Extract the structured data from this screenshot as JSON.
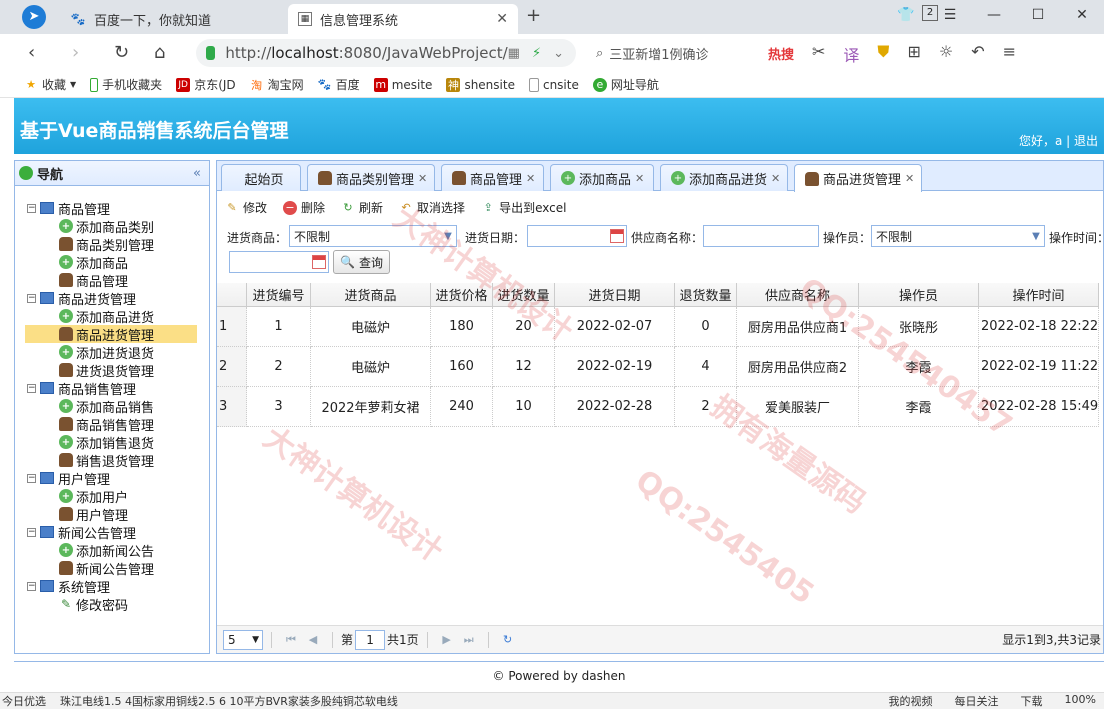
{
  "browser": {
    "tabs": [
      {
        "label": "百度一下，你就知道",
        "icon": "baidu-paw-icon"
      },
      {
        "label": "信息管理系统",
        "icon": "page-icon"
      }
    ],
    "tab_count": "2",
    "url_host": "http://",
    "url_main": "localhost",
    "url_rest": ":8080/JavaWebProject/",
    "search_text": "三亚新增1例确诊",
    "search_hot": "热搜",
    "bookmarks": [
      "收藏",
      "手机收藏夹",
      "京东(JD",
      "淘宝网",
      "百度",
      "mesite",
      "shensite",
      "cnsite",
      "网址导航"
    ],
    "status_left": "今日优选",
    "status_ticker": "珠江电线1.5 4国标家用铜线2.5 6 10平方BVR家装多股纯铜芯软电线",
    "status_right": [
      "我的视频",
      "每日关注",
      "下载",
      "100%"
    ]
  },
  "app": {
    "title": "基于Vue商品销售系统后台管理",
    "welcome": "您好，a",
    "logout": "退出",
    "footer": "© Powered by dashen"
  },
  "nav": {
    "title": "导航",
    "groups": [
      {
        "label": "商品管理",
        "items": [
          {
            "label": "添加商品类别",
            "icon": "add"
          },
          {
            "label": "商品类别管理",
            "icon": "user"
          },
          {
            "label": "添加商品",
            "icon": "add"
          },
          {
            "label": "商品管理",
            "icon": "user"
          }
        ]
      },
      {
        "label": "商品进货管理",
        "items": [
          {
            "label": "添加商品进货",
            "icon": "add"
          },
          {
            "label": "商品进货管理",
            "icon": "user",
            "selected": true
          },
          {
            "label": "添加进货退货",
            "icon": "add"
          },
          {
            "label": "进货退货管理",
            "icon": "user"
          }
        ]
      },
      {
        "label": "商品销售管理",
        "items": [
          {
            "label": "添加商品销售",
            "icon": "add"
          },
          {
            "label": "商品销售管理",
            "icon": "user"
          },
          {
            "label": "添加销售退货",
            "icon": "add"
          },
          {
            "label": "销售退货管理",
            "icon": "user"
          }
        ]
      },
      {
        "label": "用户管理",
        "items": [
          {
            "label": "添加用户",
            "icon": "add"
          },
          {
            "label": "用户管理",
            "icon": "user"
          }
        ]
      },
      {
        "label": "新闻公告管理",
        "items": [
          {
            "label": "添加新闻公告",
            "icon": "add"
          },
          {
            "label": "新闻公告管理",
            "icon": "user"
          }
        ]
      },
      {
        "label": "系统管理",
        "items": [
          {
            "label": "修改密码",
            "icon": "pen"
          }
        ]
      }
    ]
  },
  "page_tabs": [
    {
      "label": "起始页",
      "closable": false
    },
    {
      "label": "商品类别管理",
      "closable": true,
      "icon": "user"
    },
    {
      "label": "商品管理",
      "closable": true,
      "icon": "user"
    },
    {
      "label": "添加商品",
      "closable": true,
      "icon": "add"
    },
    {
      "label": "添加商品进货",
      "closable": true,
      "icon": "add"
    },
    {
      "label": "商品进货管理",
      "closable": true,
      "icon": "user",
      "active": true
    }
  ],
  "toolbar": {
    "edit": "修改",
    "delete": "删除",
    "refresh": "刷新",
    "deselect": "取消选择",
    "export": "导出到excel"
  },
  "filters": {
    "product_label": "进货商品：",
    "product_value": "不限制",
    "date_label": "进货日期：",
    "supplier_label": "供应商名称：",
    "operator_label": "操作员：",
    "operator_value": "不限制",
    "optime_label": "操作时间：",
    "query": "查询"
  },
  "table": {
    "columns": [
      "进货编号",
      "进货商品",
      "进货价格",
      "进货数量",
      "进货日期",
      "退货数量",
      "供应商名称",
      "操作员",
      "操作时间"
    ],
    "rows": [
      [
        "1",
        "1",
        "电磁炉",
        "180",
        "20",
        "2022-02-07",
        "0",
        "厨房用品供应商1",
        "张晓彤",
        "2022-02-18 22:22:"
      ],
      [
        "2",
        "2",
        "电磁炉",
        "160",
        "12",
        "2022-02-19",
        "4",
        "厨房用品供应商2",
        "李霞",
        "2022-02-19 11:22:"
      ],
      [
        "3",
        "3",
        "2022年萝莉女裙",
        "240",
        "10",
        "2022-02-28",
        "2",
        "爱美服装厂",
        "李霞",
        "2022-02-28 15:49:"
      ]
    ]
  },
  "pager": {
    "page_size": "5",
    "page_prefix": "第",
    "page": "1",
    "page_suffix": "共1页",
    "info": "显示1到3,共3记录"
  },
  "watermarks": [
    "大神计算机设计",
    "QQ:2545405",
    "拥有海量源码",
    "QQ:254540457"
  ]
}
